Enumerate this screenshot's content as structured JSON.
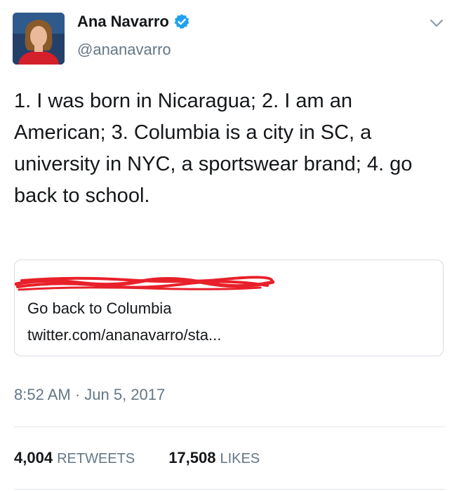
{
  "tweet": {
    "author_name": "Ana Navarro",
    "author_handle": "@ananavarro",
    "verified_icon": "verified-badge-icon",
    "menu_icon": "chevron-down-icon",
    "text": "1. I was born in Nicaragua; 2. I am an American; 3. Columbia is a city in SC, a university in NYC, a sportswear brand; 4. go back to school.",
    "timestamp": "8:52 AM · Jun 5, 2017"
  },
  "quoted_tweet": {
    "text": "Go back to Columbia",
    "link": "twitter.com/ananavarro/sta..."
  },
  "stats": {
    "retweets_count": "4,004",
    "retweets_label": "RETWEETS",
    "likes_count": "17,508",
    "likes_label": "LIKES"
  },
  "colors": {
    "verified_blue": "#1da1f2",
    "scribble_red": "#e8202a",
    "secondary_text": "#657786"
  }
}
